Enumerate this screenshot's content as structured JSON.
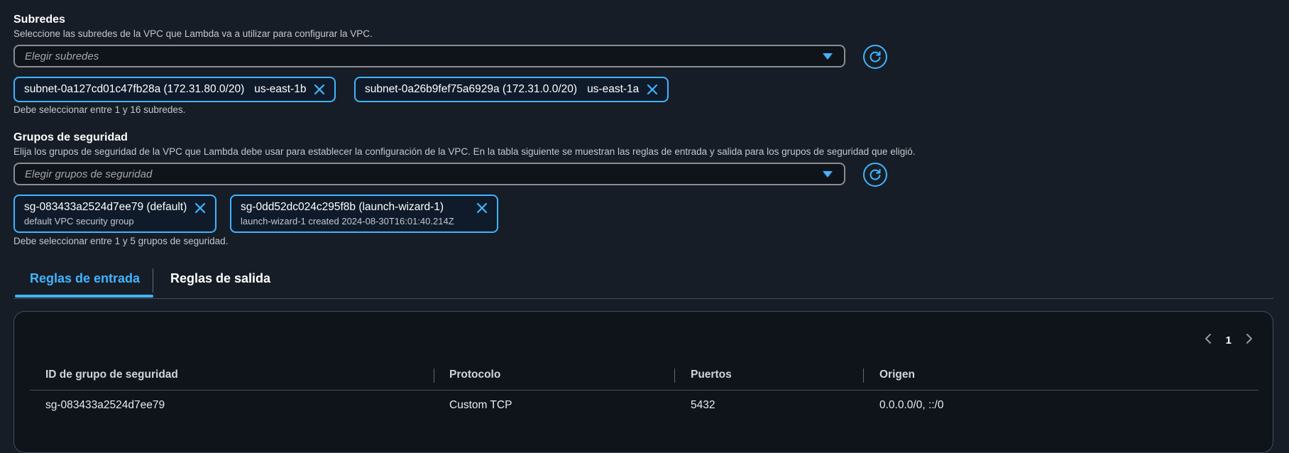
{
  "subnets": {
    "label": "Subredes",
    "description": "Seleccione las subredes de la VPC que Lambda va a utilizar para configurar la VPC.",
    "placeholder": "Elegir subredes",
    "tokens": [
      {
        "name": "subnet-0a127cd01c47fb28a (172.31.80.0/20)",
        "region": "us-east-1b"
      },
      {
        "name": "subnet-0a26b9fef75a6929a (172.31.0.0/20)",
        "region": "us-east-1a"
      }
    ],
    "hint": "Debe seleccionar entre 1 y 16 subredes."
  },
  "security_groups": {
    "label": "Grupos de seguridad",
    "description": "Elija los grupos de seguridad de la VPC que Lambda debe usar para establecer la configuración de la VPC. En la tabla siguiente se muestran las reglas de entrada y salida para los grupos de seguridad que eligió.",
    "placeholder": "Elegir grupos de seguridad",
    "tokens": [
      {
        "name": "sg-083433a2524d7ee79 (default)",
        "description": "default VPC security group"
      },
      {
        "name": "sg-0dd52dc024c295f8b (launch-wizard-1)",
        "description": "launch-wizard-1 created 2024-08-30T16:01:40.214Z"
      }
    ],
    "hint": "Debe seleccionar entre 1 y 5 grupos de seguridad."
  },
  "tabs": [
    {
      "label": "Reglas de entrada",
      "active": true
    },
    {
      "label": "Reglas de salida",
      "active": false
    }
  ],
  "pagination": {
    "current_page": "1"
  },
  "table": {
    "columns": [
      "ID de grupo de seguridad",
      "Protocolo",
      "Puertos",
      "Origen"
    ],
    "rows": [
      [
        "sg-083433a2524d7ee79",
        "Custom TCP",
        "5432",
        "0.0.0.0/0, ::/0"
      ]
    ]
  },
  "colors": {
    "accent": "#42b4ff",
    "background": "#161d26"
  },
  "icons": [
    "caret-down-icon",
    "refresh-icon",
    "close-icon",
    "chevron-left-icon",
    "chevron-right-icon"
  ]
}
